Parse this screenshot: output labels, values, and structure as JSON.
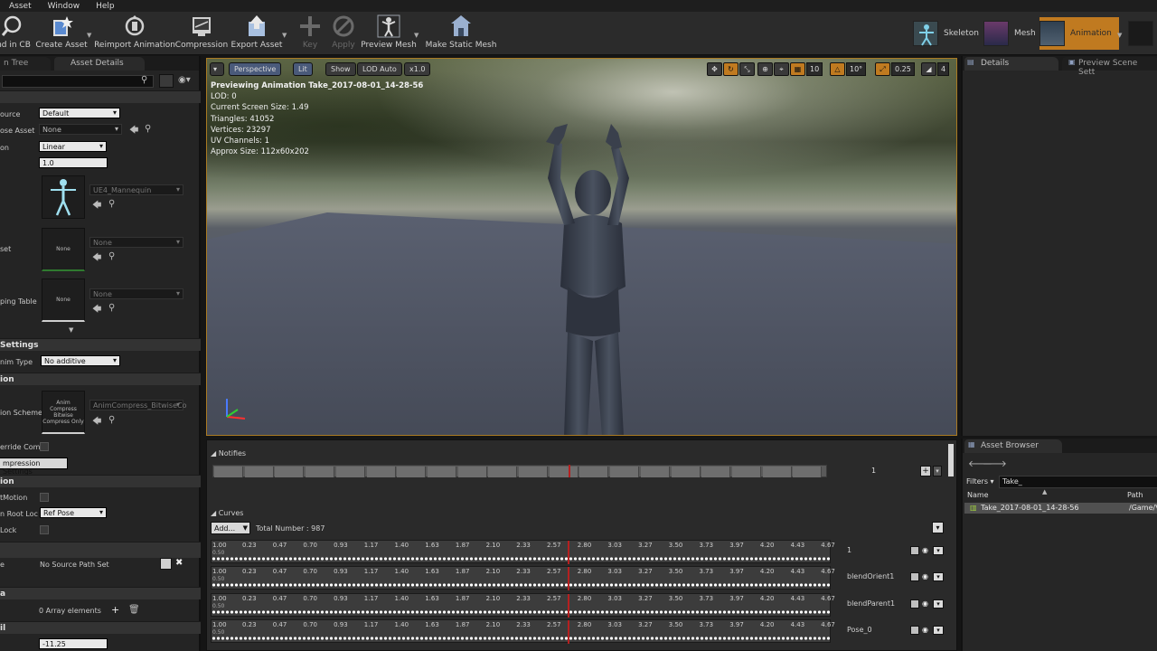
{
  "menu": [
    "Asset",
    "Window",
    "Help"
  ],
  "toolbar": {
    "buttons": [
      {
        "label": "nd in CB",
        "icon": "magnify-icon"
      },
      {
        "label": "Create Asset",
        "icon": "create-asset-icon"
      },
      {
        "label": "Reimport Animation",
        "icon": "reimport-icon"
      },
      {
        "label": "Compression",
        "icon": "compression-icon"
      },
      {
        "label": "Export Asset",
        "icon": "export-icon"
      },
      {
        "label": "Key",
        "icon": "plus-icon"
      },
      {
        "label": "Apply",
        "icon": "apply-icon"
      },
      {
        "label": "Preview Mesh",
        "icon": "preview-mesh-icon"
      },
      {
        "label": "Make Static Mesh",
        "icon": "static-mesh-icon"
      }
    ],
    "modes": [
      {
        "label": "Skeleton"
      },
      {
        "label": "Mesh"
      },
      {
        "label": "Animation"
      }
    ]
  },
  "left_panel": {
    "tabs": [
      "n Tree",
      "Asset Details"
    ],
    "sections": {
      "settings": "Settings",
      "compression": "ion",
      "root_motion": "ion",
      "misc": "a",
      "extra": "il"
    },
    "fields": {
      "source_label": "ource",
      "source_value": "Default",
      "pose_asset_label": "ose Asset",
      "pose_asset_value": "None",
      "interp_label": "on",
      "interp_value": "Linear",
      "rate_label": "",
      "rate_value": "1.0",
      "skeleton_value": "UE4_Mannequin",
      "asset_label": "set",
      "asset_value": "None",
      "asset_thumb": "None",
      "mapping_label": "ping Table",
      "mapping_value": "None",
      "mapping_thumb": "None",
      "additive_label": "nim Type",
      "additive_value": "No additive",
      "scheme_label": "ion Scheme",
      "scheme_thumb": "Anim Compress Bitwise Compress Only",
      "scheme_value": "AnimCompress_BitwiseCo",
      "override_label": "erride Comp",
      "comp_settings_btn": "mpression Settings",
      "root_motion_label": "tMotion",
      "root_lock_label": "n Root Loc",
      "root_lock_value": "Ref Pose",
      "lock_label": "Lock",
      "source_path_label": "e",
      "source_path_value": "No Source Path Set",
      "array_value": "0 Array elements",
      "bottom_value": "-11.25"
    }
  },
  "viewport": {
    "buttons": {
      "perspective": "Perspective",
      "lit": "Lit",
      "show": "Show",
      "lod": "LOD Auto",
      "speed": "x1.0"
    },
    "tools": {
      "grid_value": "10",
      "angle_value": "10°",
      "scale_value": "0.25",
      "cam_value": "4"
    },
    "info": {
      "title": "Previewing Animation Take_2017-08-01_14-28-56",
      "lines": [
        "LOD: 0",
        "Current Screen Size: 1.49",
        "Triangles: 41052",
        "Vertices: 23297",
        "UV Channels: 1",
        "Approx Size: 112x60x202"
      ]
    }
  },
  "notifies": {
    "title": "Notifies",
    "track_number": "1"
  },
  "curves": {
    "title": "Curves",
    "add_label": "Add...",
    "total": "Total Number : 987",
    "ticks": [
      "1.00",
      "0.23",
      "0.47",
      "0.70",
      "0.93",
      "1.17",
      "1.40",
      "1.63",
      "1.87",
      "2.10",
      "2.33",
      "2.57",
      "2.80",
      "3.03",
      "3.27",
      "3.50",
      "3.73",
      "3.97",
      "4.20",
      "4.43",
      "4.67"
    ],
    "mid_value": "0.50",
    "rows": [
      {
        "name": "1"
      },
      {
        "name": "blendOrient1"
      },
      {
        "name": "blendParent1"
      },
      {
        "name": "Pose_0"
      }
    ]
  },
  "right_panel": {
    "tabs": [
      "Details",
      "Preview Scene Sett"
    ],
    "asset_browser": {
      "tab": "Asset Browser",
      "filters": "Filters",
      "search": "Take_",
      "col_name": "Name",
      "col_path": "Path",
      "item_name": "Take_2017-08-01_14-28-56",
      "item_path": "/Game/V"
    }
  },
  "colors": {
    "accent_orange": "#c07a20",
    "playhead_red": "#b52020",
    "highlight_green": "#a0d040"
  }
}
